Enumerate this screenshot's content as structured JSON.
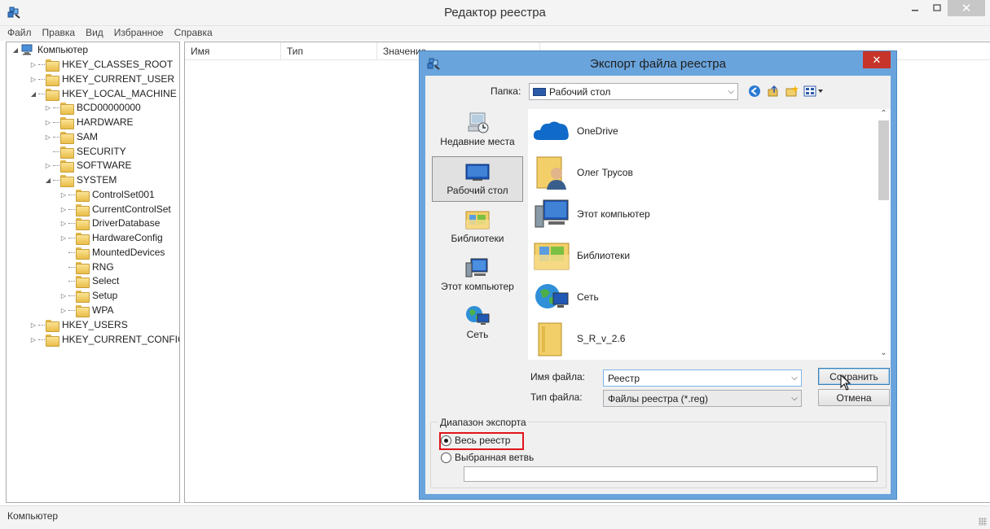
{
  "main_window": {
    "title": "Редактор реестра",
    "menu": [
      "Файл",
      "Правка",
      "Вид",
      "Избранное",
      "Справка"
    ],
    "tree": [
      {
        "label": "Компьютер",
        "expanded": true,
        "level": 0
      },
      {
        "label": "HKEY_CLASSES_ROOT",
        "level": 1
      },
      {
        "label": "HKEY_CURRENT_USER",
        "level": 1
      },
      {
        "label": "HKEY_LOCAL_MACHINE",
        "expanded": true,
        "level": 1
      },
      {
        "label": "BCD00000000",
        "level": 2
      },
      {
        "label": "HARDWARE",
        "level": 2
      },
      {
        "label": "SAM",
        "level": 2
      },
      {
        "label": "SECURITY",
        "level": 2
      },
      {
        "label": "SOFTWARE",
        "level": 2
      },
      {
        "label": "SYSTEM",
        "expanded": true,
        "level": 2
      },
      {
        "label": "ControlSet001",
        "level": 3
      },
      {
        "label": "CurrentControlSet",
        "level": 3
      },
      {
        "label": "DriverDatabase",
        "level": 3
      },
      {
        "label": "HardwareConfig",
        "level": 3
      },
      {
        "label": "MountedDevices",
        "level": 3
      },
      {
        "label": "RNG",
        "level": 3
      },
      {
        "label": "Select",
        "level": 3
      },
      {
        "label": "Setup",
        "level": 3
      },
      {
        "label": "WPA",
        "level": 3
      },
      {
        "label": "HKEY_USERS",
        "level": 1
      },
      {
        "label": "HKEY_CURRENT_CONFIG",
        "level": 1
      }
    ],
    "columns": [
      "Имя",
      "Тип",
      "Значение"
    ],
    "status": "Компьютер"
  },
  "dialog": {
    "title": "Экспорт файла реестра",
    "folder_label": "Папка:",
    "folder_value": "Рабочий стол",
    "places": [
      "Недавние места",
      "Рабочий стол",
      "Библиотеки",
      "Этот компьютер",
      "Сеть"
    ],
    "selected_place": "Рабочий стол",
    "files": [
      "OneDrive",
      "Олег Трусов",
      "Этот компьютер",
      "Библиотеки",
      "Сеть",
      "S_R_v_2.6"
    ],
    "filename_label": "Имя файла:",
    "filename_value": "Реестр",
    "filetype_label": "Тип файла:",
    "filetype_value": "Файлы реестра (*.reg)",
    "save_label": "Сохранить",
    "cancel_label": "Отмена",
    "export_range_label": "Диапазон экспорта",
    "radio_all": "Весь реестр",
    "radio_branch": "Выбранная ветвь",
    "radio_selected": "all",
    "highlight_color": "#e0141b",
    "close_color": "#c7352a",
    "frame_color": "#6aa4dc"
  }
}
